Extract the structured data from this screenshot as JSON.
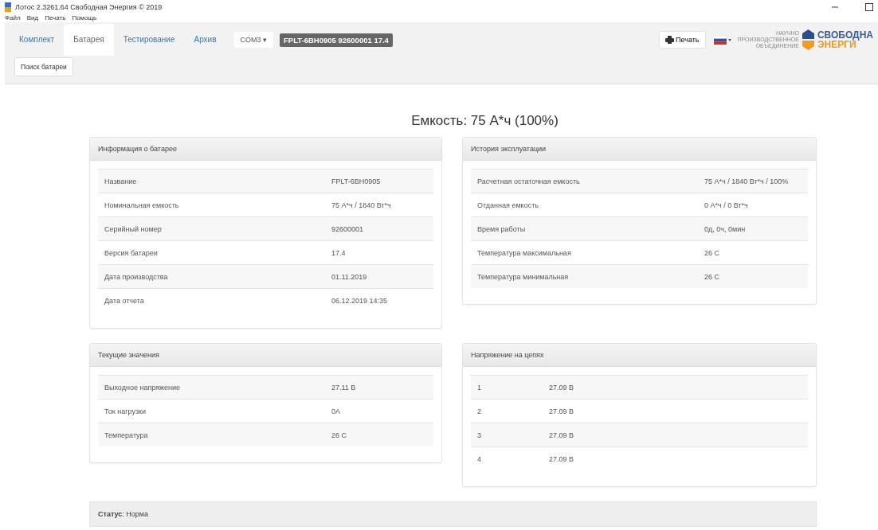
{
  "window": {
    "title": "Лотос 2.3261.64 Свободная Энергия © 2019"
  },
  "menu": [
    "Файл",
    "Вид",
    "Печать",
    "Помощь"
  ],
  "tabs": [
    {
      "label": "Комплект",
      "selected": false
    },
    {
      "label": "Батарея",
      "selected": true
    },
    {
      "label": "Тестирование",
      "selected": false
    },
    {
      "label": "Архив",
      "selected": false
    }
  ],
  "port": {
    "label": "COM3",
    "caret": "▾"
  },
  "device_badge": "FPLT-6BH0905 92600001 17.4",
  "print_button": "Печать",
  "logo": {
    "subtitle": [
      "НАУЧНО",
      "ПРОИЗВОДСТВЕННОЕ",
      "ОБЪЕДИНЕНИЕ"
    ],
    "line_1": "СВОБОДНА",
    "line_2": "ЭНЕРГИ"
  },
  "search_button": "Поиск батареи",
  "heading": "Емкость: 75 А*ч (100%)",
  "panels": [
    {
      "title": "Информация о батарее",
      "kind": "details",
      "rows": [
        [
          "Название",
          "FPLT-6BH0905"
        ],
        [
          "Номинальная емкость",
          "75 А*ч / 1840 Вт*ч"
        ],
        [
          "Серийный номер",
          "92600001"
        ],
        [
          "Версия батареи",
          "17.4"
        ],
        [
          "Дата производства",
          "01.11.2019"
        ],
        [
          "Дата отчета",
          "06.12.2019 14:35"
        ]
      ]
    },
    {
      "title": "История эксплуатации",
      "kind": "details",
      "rows": [
        [
          "Расчетная остаточная емкость",
          "75 А*ч / 1840 Вт*ч / 100%"
        ],
        [
          "Отданная емкость",
          "0 А*ч / 0 Вт*ч"
        ],
        [
          "Время работы",
          "0д, 0ч, 0мин"
        ],
        [
          "Температура максимальная",
          "26 C"
        ],
        [
          "Температура минимальная",
          "26 C"
        ]
      ]
    },
    {
      "title": "Текущие значения",
      "kind": "details",
      "rows": [
        [
          "Выходное напряжение",
          "27.11 В"
        ],
        [
          "Ток нагрузки",
          "0A"
        ],
        [
          "Температура",
          "26 C"
        ]
      ]
    },
    {
      "title": "Напряжение на цепях",
      "kind": "numbered",
      "rows": [
        [
          "1",
          "27.09 В"
        ],
        [
          "2",
          "27.09 В"
        ],
        [
          "3",
          "27.09 В"
        ],
        [
          "4",
          "27.09 В"
        ]
      ]
    }
  ],
  "status": "**Статус**: Норма"
}
